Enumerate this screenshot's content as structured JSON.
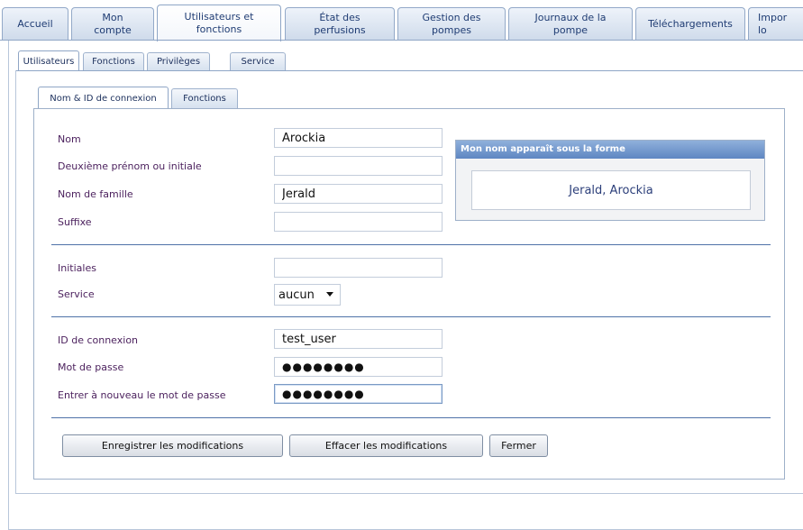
{
  "top_tabs": [
    {
      "label": "Accueil"
    },
    {
      "label": "Mon\ncompte"
    },
    {
      "label": "Utilisateurs et\nfonctions"
    },
    {
      "label": "État des\nperfusions"
    },
    {
      "label": "Gestion des\npompes"
    },
    {
      "label": "Journaux de la\npompe"
    },
    {
      "label": "Téléchargements"
    },
    {
      "label": "Impor\nlo"
    }
  ],
  "sub_tabs": [
    {
      "label": "Utilisateurs"
    },
    {
      "label": "Fonctions"
    },
    {
      "label": "Privilèges"
    },
    {
      "label": "Service"
    }
  ],
  "inner_tabs": [
    {
      "label": "Nom & ID de connexion"
    },
    {
      "label": "Fonctions"
    }
  ],
  "form": {
    "first_name": {
      "label": "Nom",
      "value": "Arockia"
    },
    "middle_name": {
      "label": "Deuxième prénom ou initiale",
      "value": ""
    },
    "last_name": {
      "label": "Nom de famille",
      "value": "Jerald"
    },
    "suffix": {
      "label": "Suffixe",
      "value": ""
    },
    "initials": {
      "label": "Initiales",
      "value": ""
    },
    "service": {
      "label": "Service",
      "selected": "aucun"
    },
    "login_id": {
      "label": "ID de connexion",
      "value": "test_user"
    },
    "password": {
      "label": "Mot de passe",
      "value": "●●●●●●●●"
    },
    "password_confirm": {
      "label": "Entrer à nouveau le mot de passe",
      "value": "●●●●●●●●"
    }
  },
  "name_display": {
    "title": "Mon nom apparaît sous la forme",
    "value": "Jerald, Arockia"
  },
  "buttons": {
    "save": "Enregistrer les modifications",
    "clear": "Effacer les modifications",
    "close": "Fermer"
  },
  "colors": {
    "accent": "#5e86c2",
    "label_text": "#4a1f5c",
    "separator": "#4f72a8"
  }
}
